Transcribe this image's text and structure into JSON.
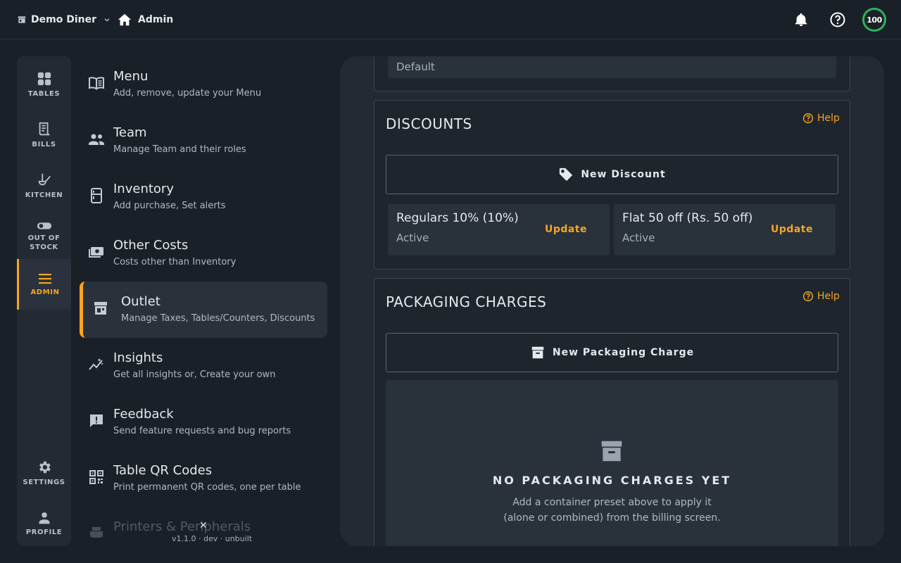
{
  "header": {
    "restaurant": "Demo Diner",
    "breadcrumb": "Admin",
    "credits": "100"
  },
  "rail": {
    "items": [
      {
        "label": "TABLES",
        "icon": "grid-icon"
      },
      {
        "label": "BILLS",
        "icon": "receipt-icon"
      },
      {
        "label": "KITCHEN",
        "icon": "ladle-icon"
      },
      {
        "label_line1": "OUT OF",
        "label_line2": "STOCK",
        "icon": "toggle-icon"
      },
      {
        "label": "ADMIN",
        "icon": "hamburger-icon",
        "active": true
      },
      {
        "label": "SETTINGS",
        "icon": "gear-icon"
      },
      {
        "label": "PROFILE",
        "icon": "person-icon"
      }
    ]
  },
  "menu": {
    "items": [
      {
        "title": "Menu",
        "subtitle": "Add, remove, update your Menu"
      },
      {
        "title": "Team",
        "subtitle": "Manage Team and their roles"
      },
      {
        "title": "Inventory",
        "subtitle": "Add purchase, Set alerts"
      },
      {
        "title": "Other Costs",
        "subtitle": "Costs other than Inventory"
      },
      {
        "title": "Outlet",
        "subtitle": "Manage Taxes, Tables/Counters, Discounts",
        "active": true
      },
      {
        "title": "Insights",
        "subtitle": "Get all insights or, Create your own"
      },
      {
        "title": "Feedback",
        "subtitle": "Send feature requests and bug reports"
      },
      {
        "title": "Table QR Codes",
        "subtitle": "Print permanent QR codes, one per table"
      },
      {
        "title": "Printers & Peripherals",
        "subtitle": ""
      }
    ]
  },
  "version": "v1.1.0 · dev · unbuilt",
  "outlet": {
    "top_card": {
      "status": "Default"
    },
    "discounts": {
      "title": "DISCOUNTS",
      "help": "Help",
      "new_button": "New Discount",
      "items": [
        {
          "name": "Regulars 10% (10%)",
          "status": "Active",
          "action": "Update"
        },
        {
          "name": "Flat 50 off (Rs. 50 off)",
          "status": "Active",
          "action": "Update"
        }
      ]
    },
    "packaging": {
      "title": "PACKAGING CHARGES",
      "help": "Help",
      "new_button": "New Packaging Charge",
      "empty_title": "NO PACKAGING CHARGES YET",
      "empty_line1": "Add a container preset above to apply it",
      "empty_line2": "(alone or combined) from the billing screen."
    }
  },
  "colors": {
    "accent": "#f5a623",
    "background": "#1a2028",
    "panel": "#232a33",
    "success": "#2fb35a"
  }
}
